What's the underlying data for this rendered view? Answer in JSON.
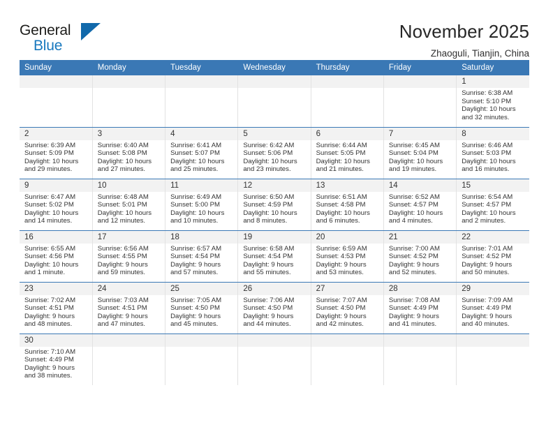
{
  "brand": {
    "name_top": "General",
    "name_bottom": "Blue",
    "accent_color": "#1878be",
    "triangle_color": "#1169ab"
  },
  "header": {
    "title": "November 2025",
    "subtitle": "Zhaoguli, Tianjin, China"
  },
  "calendar": {
    "header_bg": "#3a78b5",
    "daynum_bg": "#f2f2f2",
    "weekdays": [
      "Sunday",
      "Monday",
      "Tuesday",
      "Wednesday",
      "Thursday",
      "Friday",
      "Saturday"
    ],
    "labels": {
      "sunrise": "Sunrise:",
      "sunset": "Sunset:",
      "daylight": "Daylight:"
    },
    "weeks": [
      [
        {
          "day": ""
        },
        {
          "day": ""
        },
        {
          "day": ""
        },
        {
          "day": ""
        },
        {
          "day": ""
        },
        {
          "day": ""
        },
        {
          "day": "1",
          "sunrise": "Sunrise: 6:38 AM",
          "sunset": "Sunset: 5:10 PM",
          "daylight1": "Daylight: 10 hours",
          "daylight2": "and 32 minutes."
        }
      ],
      [
        {
          "day": "2",
          "sunrise": "Sunrise: 6:39 AM",
          "sunset": "Sunset: 5:09 PM",
          "daylight1": "Daylight: 10 hours",
          "daylight2": "and 29 minutes."
        },
        {
          "day": "3",
          "sunrise": "Sunrise: 6:40 AM",
          "sunset": "Sunset: 5:08 PM",
          "daylight1": "Daylight: 10 hours",
          "daylight2": "and 27 minutes."
        },
        {
          "day": "4",
          "sunrise": "Sunrise: 6:41 AM",
          "sunset": "Sunset: 5:07 PM",
          "daylight1": "Daylight: 10 hours",
          "daylight2": "and 25 minutes."
        },
        {
          "day": "5",
          "sunrise": "Sunrise: 6:42 AM",
          "sunset": "Sunset: 5:06 PM",
          "daylight1": "Daylight: 10 hours",
          "daylight2": "and 23 minutes."
        },
        {
          "day": "6",
          "sunrise": "Sunrise: 6:44 AM",
          "sunset": "Sunset: 5:05 PM",
          "daylight1": "Daylight: 10 hours",
          "daylight2": "and 21 minutes."
        },
        {
          "day": "7",
          "sunrise": "Sunrise: 6:45 AM",
          "sunset": "Sunset: 5:04 PM",
          "daylight1": "Daylight: 10 hours",
          "daylight2": "and 19 minutes."
        },
        {
          "day": "8",
          "sunrise": "Sunrise: 6:46 AM",
          "sunset": "Sunset: 5:03 PM",
          "daylight1": "Daylight: 10 hours",
          "daylight2": "and 16 minutes."
        }
      ],
      [
        {
          "day": "9",
          "sunrise": "Sunrise: 6:47 AM",
          "sunset": "Sunset: 5:02 PM",
          "daylight1": "Daylight: 10 hours",
          "daylight2": "and 14 minutes."
        },
        {
          "day": "10",
          "sunrise": "Sunrise: 6:48 AM",
          "sunset": "Sunset: 5:01 PM",
          "daylight1": "Daylight: 10 hours",
          "daylight2": "and 12 minutes."
        },
        {
          "day": "11",
          "sunrise": "Sunrise: 6:49 AM",
          "sunset": "Sunset: 5:00 PM",
          "daylight1": "Daylight: 10 hours",
          "daylight2": "and 10 minutes."
        },
        {
          "day": "12",
          "sunrise": "Sunrise: 6:50 AM",
          "sunset": "Sunset: 4:59 PM",
          "daylight1": "Daylight: 10 hours",
          "daylight2": "and 8 minutes."
        },
        {
          "day": "13",
          "sunrise": "Sunrise: 6:51 AM",
          "sunset": "Sunset: 4:58 PM",
          "daylight1": "Daylight: 10 hours",
          "daylight2": "and 6 minutes."
        },
        {
          "day": "14",
          "sunrise": "Sunrise: 6:52 AM",
          "sunset": "Sunset: 4:57 PM",
          "daylight1": "Daylight: 10 hours",
          "daylight2": "and 4 minutes."
        },
        {
          "day": "15",
          "sunrise": "Sunrise: 6:54 AM",
          "sunset": "Sunset: 4:57 PM",
          "daylight1": "Daylight: 10 hours",
          "daylight2": "and 2 minutes."
        }
      ],
      [
        {
          "day": "16",
          "sunrise": "Sunrise: 6:55 AM",
          "sunset": "Sunset: 4:56 PM",
          "daylight1": "Daylight: 10 hours",
          "daylight2": "and 1 minute."
        },
        {
          "day": "17",
          "sunrise": "Sunrise: 6:56 AM",
          "sunset": "Sunset: 4:55 PM",
          "daylight1": "Daylight: 9 hours",
          "daylight2": "and 59 minutes."
        },
        {
          "day": "18",
          "sunrise": "Sunrise: 6:57 AM",
          "sunset": "Sunset: 4:54 PM",
          "daylight1": "Daylight: 9 hours",
          "daylight2": "and 57 minutes."
        },
        {
          "day": "19",
          "sunrise": "Sunrise: 6:58 AM",
          "sunset": "Sunset: 4:54 PM",
          "daylight1": "Daylight: 9 hours",
          "daylight2": "and 55 minutes."
        },
        {
          "day": "20",
          "sunrise": "Sunrise: 6:59 AM",
          "sunset": "Sunset: 4:53 PM",
          "daylight1": "Daylight: 9 hours",
          "daylight2": "and 53 minutes."
        },
        {
          "day": "21",
          "sunrise": "Sunrise: 7:00 AM",
          "sunset": "Sunset: 4:52 PM",
          "daylight1": "Daylight: 9 hours",
          "daylight2": "and 52 minutes."
        },
        {
          "day": "22",
          "sunrise": "Sunrise: 7:01 AM",
          "sunset": "Sunset: 4:52 PM",
          "daylight1": "Daylight: 9 hours",
          "daylight2": "and 50 minutes."
        }
      ],
      [
        {
          "day": "23",
          "sunrise": "Sunrise: 7:02 AM",
          "sunset": "Sunset: 4:51 PM",
          "daylight1": "Daylight: 9 hours",
          "daylight2": "and 48 minutes."
        },
        {
          "day": "24",
          "sunrise": "Sunrise: 7:03 AM",
          "sunset": "Sunset: 4:51 PM",
          "daylight1": "Daylight: 9 hours",
          "daylight2": "and 47 minutes."
        },
        {
          "day": "25",
          "sunrise": "Sunrise: 7:05 AM",
          "sunset": "Sunset: 4:50 PM",
          "daylight1": "Daylight: 9 hours",
          "daylight2": "and 45 minutes."
        },
        {
          "day": "26",
          "sunrise": "Sunrise: 7:06 AM",
          "sunset": "Sunset: 4:50 PM",
          "daylight1": "Daylight: 9 hours",
          "daylight2": "and 44 minutes."
        },
        {
          "day": "27",
          "sunrise": "Sunrise: 7:07 AM",
          "sunset": "Sunset: 4:50 PM",
          "daylight1": "Daylight: 9 hours",
          "daylight2": "and 42 minutes."
        },
        {
          "day": "28",
          "sunrise": "Sunrise: 7:08 AM",
          "sunset": "Sunset: 4:49 PM",
          "daylight1": "Daylight: 9 hours",
          "daylight2": "and 41 minutes."
        },
        {
          "day": "29",
          "sunrise": "Sunrise: 7:09 AM",
          "sunset": "Sunset: 4:49 PM",
          "daylight1": "Daylight: 9 hours",
          "daylight2": "and 40 minutes."
        }
      ],
      [
        {
          "day": "30",
          "sunrise": "Sunrise: 7:10 AM",
          "sunset": "Sunset: 4:49 PM",
          "daylight1": "Daylight: 9 hours",
          "daylight2": "and 38 minutes."
        },
        {
          "day": ""
        },
        {
          "day": ""
        },
        {
          "day": ""
        },
        {
          "day": ""
        },
        {
          "day": ""
        },
        {
          "day": ""
        }
      ]
    ]
  }
}
